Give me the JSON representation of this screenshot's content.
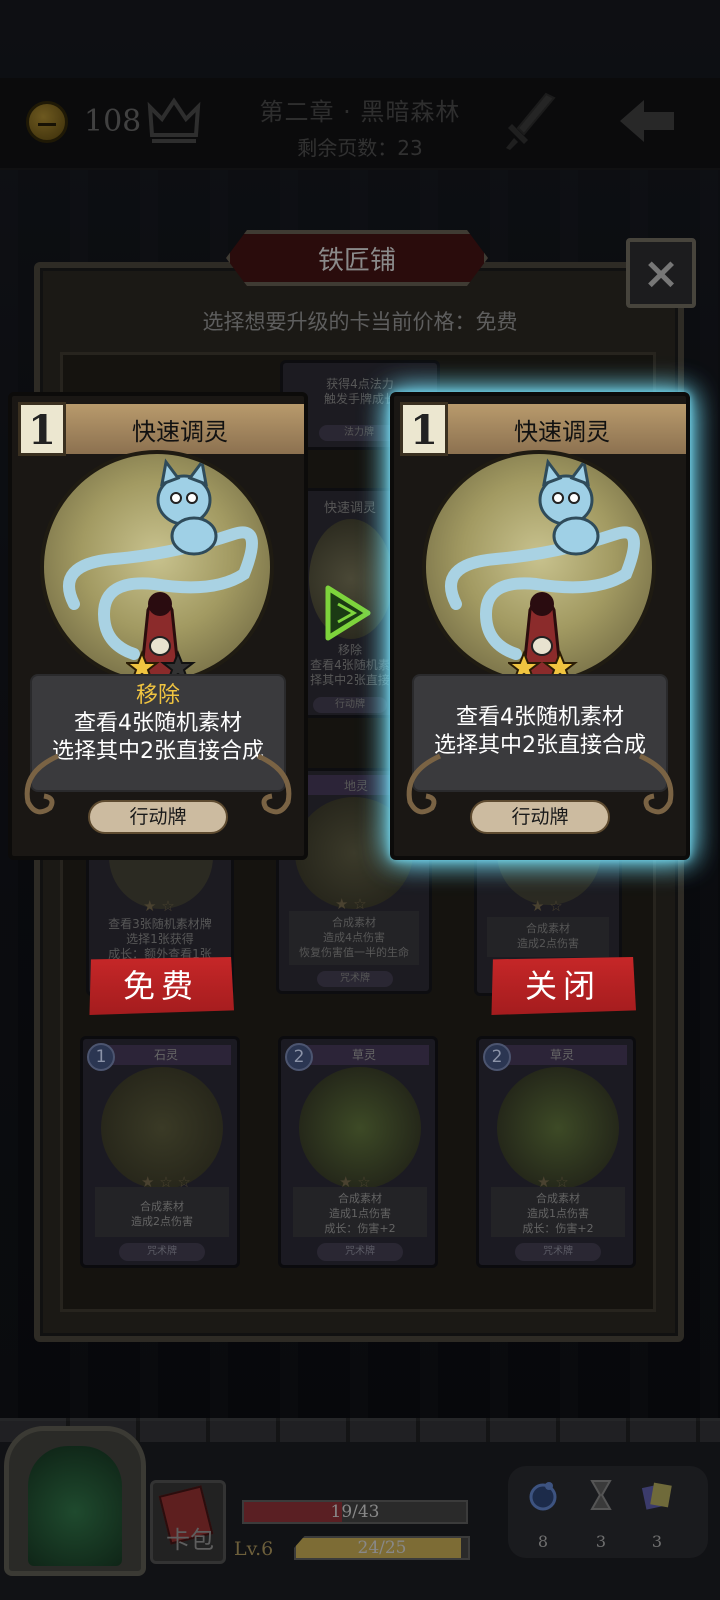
{
  "header": {
    "gold": "108",
    "chapter": "第二章 · 黑暗森林",
    "pages_remaining": "剩余页数：23"
  },
  "smithy": {
    "title": "铁匠铺",
    "subtitle": "选择想要升级的卡当前价格：免费",
    "close_icon": "×"
  },
  "upgrade_compare": {
    "current": {
      "cost": "1",
      "name": "快速调灵",
      "stars_filled": 1,
      "stars_total": 2,
      "keyword": "移除",
      "lines": [
        "查看4张随机素材",
        "选择其中2张直接合成"
      ],
      "type": "行动牌"
    },
    "upgraded": {
      "cost": "1",
      "name": "快速调灵",
      "stars_filled": 2,
      "stars_total": 2,
      "lines": [
        "查看4张随机素材",
        "选择其中2张直接合成"
      ],
      "type": "行动牌"
    }
  },
  "background_cards": {
    "top_mid_lines": [
      "获得4点法力",
      "触发手牌成长"
    ],
    "top_mid_tag": "法力牌",
    "mid_name": "快速调灵",
    "mid_lines": [
      "移除",
      "查看4张随机素",
      "择其中2张直接"
    ],
    "mid_tag": "行动牌",
    "row2": [
      {
        "lines": [
          "查看3张随机素材牌",
          "选择1张获得",
          "成长：额外查看1张"
        ]
      },
      {
        "name": "地灵",
        "lines": [
          "合成素材",
          "造成4点伤害",
          "恢复伤害值一半的生命"
        ],
        "tag": "咒术牌"
      },
      {
        "lines": [
          "合成素材",
          "造成2点伤害"
        ]
      }
    ],
    "row3": [
      {
        "cost": "1",
        "name": "石灵",
        "lines": [
          "合成素材",
          "造成2点伤害"
        ],
        "tag": "咒术牌"
      },
      {
        "cost": "2",
        "name": "草灵",
        "lines": [
          "合成素材",
          "造成1点伤害",
          "成长：伤害+2"
        ],
        "tag": "咒术牌"
      },
      {
        "cost": "2",
        "name": "草灵",
        "lines": [
          "合成素材",
          "造成1点伤害",
          "成长：伤害+2"
        ],
        "tag": "咒术牌"
      }
    ]
  },
  "actions": {
    "free": "免费",
    "close": "关闭"
  },
  "footer": {
    "bag_label": "卡包",
    "hp": "19/43",
    "hp_fraction": 0.44,
    "level": "Lv.6",
    "xp": "24/25",
    "xp_fraction": 0.96,
    "resources": [
      "8",
      "3",
      "3"
    ]
  },
  "colors": {
    "accent_red": "#c62728",
    "glow_cyan": "#78e6ff",
    "keyword_gold": "#f0c440"
  }
}
